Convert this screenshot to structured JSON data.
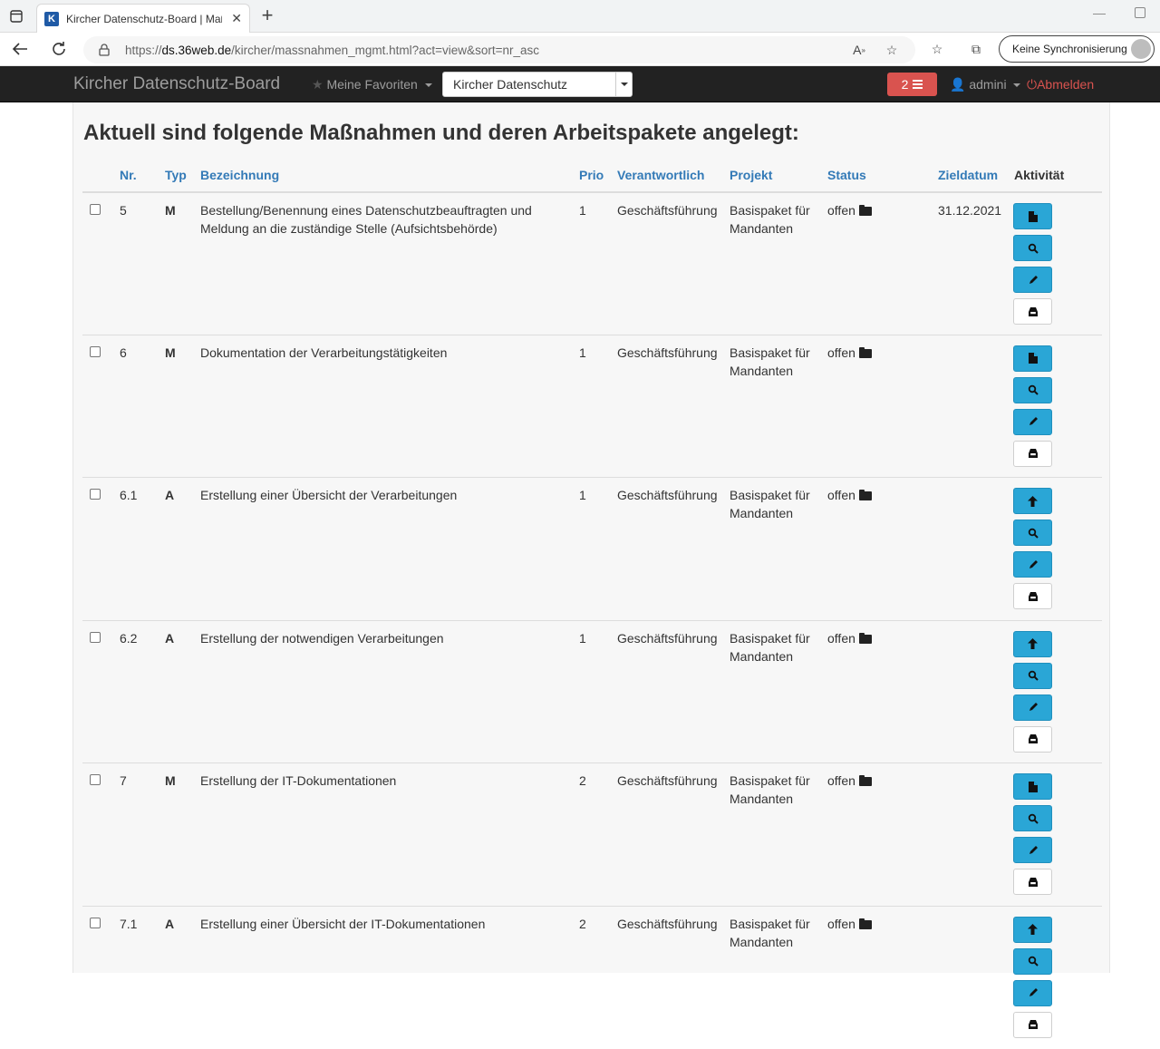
{
  "browser": {
    "tab_title": "Kircher Datenschutz-Board | Maßnahmen",
    "favicon_letter": "K",
    "url_prefix": "https://",
    "url_host": "ds.36web.de",
    "url_path": "/kircher/massnahmen_mgmt.html?act=view&sort=nr_asc",
    "sync_label": "Keine Synchronisierung"
  },
  "navbar": {
    "brand": "Kircher Datenschutz-Board",
    "favorites_label": "Meine Favoriten",
    "project_selected": "Kircher Datenschutz",
    "badge_count": "2",
    "user_label": "admini",
    "logout_label": "Abmelden"
  },
  "page": {
    "title": "Aktuell sind folgende Maßnahmen und deren Arbeitspakete angelegt:"
  },
  "table": {
    "headers": {
      "nr": "Nr.",
      "typ": "Typ",
      "bezeichnung": "Bezeichnung",
      "prio": "Prio",
      "verantwortlich": "Verantwortlich",
      "projekt": "Projekt",
      "status": "Status",
      "zieldatum": "Zieldatum",
      "aktivitaet": "Aktivität"
    },
    "rows": [
      {
        "nr": "5",
        "typ": "M",
        "bez1": "Bestellung/Benennung eines Datenschutzbeauftragten und",
        "bez2": "Meldung an die zuständige Stelle (Aufsichtsbehörde)",
        "prio": "1",
        "verantwortlich": "Geschäftsführung",
        "projekt1": "Basispaket für",
        "projekt2": "Mandanten",
        "status": "offen",
        "zieldatum": "31.12.2021",
        "first_action_icon": "file-icon"
      },
      {
        "nr": "6",
        "typ": "M",
        "bez1": "Dokumentation der Verarbeitungstätigkeiten",
        "bez2": "",
        "prio": "1",
        "verantwortlich": "Geschäftsführung",
        "projekt1": "Basispaket für",
        "projekt2": "Mandanten",
        "status": "offen",
        "zieldatum": "",
        "first_action_icon": "file-icon"
      },
      {
        "nr": "6.1",
        "typ": "A",
        "bez1": "Erstellung einer Übersicht der Verarbeitungen",
        "bez2": "",
        "prio": "1",
        "verantwortlich": "Geschäftsführung",
        "projekt1": "Basispaket für",
        "projekt2": "Mandanten",
        "status": "offen",
        "zieldatum": "",
        "first_action_icon": "arrow-up-icon"
      },
      {
        "nr": "6.2",
        "typ": "A",
        "bez1": "Erstellung der notwendigen Verarbeitungen",
        "bez2": "",
        "prio": "1",
        "verantwortlich": "Geschäftsführung",
        "projekt1": "Basispaket für",
        "projekt2": "Mandanten",
        "status": "offen",
        "zieldatum": "",
        "first_action_icon": "arrow-up-icon"
      },
      {
        "nr": "7",
        "typ": "M",
        "bez1": "Erstellung der IT-Dokumentationen",
        "bez2": "",
        "prio": "2",
        "verantwortlich": "Geschäftsführung",
        "projekt1": "Basispaket für",
        "projekt2": "Mandanten",
        "status": "offen",
        "zieldatum": "",
        "first_action_icon": "file-icon"
      },
      {
        "nr": "7.1",
        "typ": "A",
        "bez1": "Erstellung einer Übersicht der IT-Dokumentationen",
        "bez2": "",
        "prio": "2",
        "verantwortlich": "Geschäftsführung",
        "projekt1": "Basispaket für",
        "projekt2": "Mandanten",
        "status": "offen",
        "zieldatum": "",
        "first_action_icon": "arrow-up-icon"
      }
    ]
  },
  "colors": {
    "navbar_bg": "#222222",
    "link_blue": "#337ab7",
    "action_blue": "#2aa6d6",
    "danger_red": "#d9534f"
  }
}
